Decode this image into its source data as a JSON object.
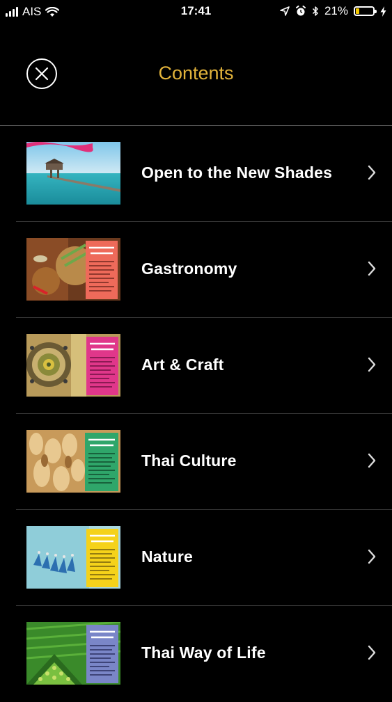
{
  "status_bar": {
    "carrier": "AIS",
    "time": "17:41",
    "battery_percent": "21%",
    "battery_level": 0.21,
    "icons": [
      "signal-icon",
      "wifi-icon",
      "location-icon",
      "alarm-icon",
      "bluetooth-icon",
      "battery-icon",
      "charging-icon"
    ]
  },
  "header": {
    "title": "Contents",
    "close_icon": "close-icon",
    "title_color": "#e2b33b"
  },
  "items": [
    {
      "label": "Open to the New Shades",
      "thumbnail": "beach-pier-image"
    },
    {
      "label": "Gastronomy",
      "thumbnail": "food-menu-image"
    },
    {
      "label": "Art & Craft",
      "thumbnail": "craft-menu-image"
    },
    {
      "label": "Thai Culture",
      "thumbnail": "culture-menu-image"
    },
    {
      "label": "Nature",
      "thumbnail": "nature-menu-image"
    },
    {
      "label": "Thai Way of Life",
      "thumbnail": "way-of-life-menu-image"
    }
  ]
}
